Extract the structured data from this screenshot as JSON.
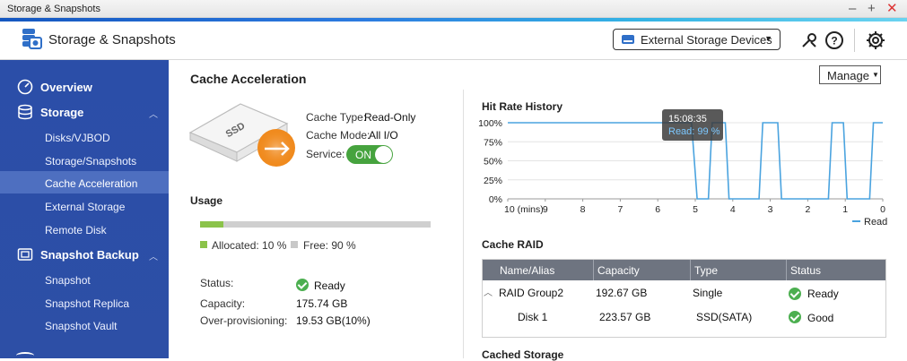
{
  "window": {
    "title": "Storage & Snapshots"
  },
  "header": {
    "app_title": "Storage & Snapshots",
    "external_devices_label": "External Storage Devices"
  },
  "sidebar": {
    "items": [
      {
        "label": "Overview",
        "type": "main"
      },
      {
        "label": "Storage",
        "type": "main"
      },
      {
        "label": "Disks/VJBOD",
        "type": "sub"
      },
      {
        "label": "Storage/Snapshots",
        "type": "sub"
      },
      {
        "label": "Cache Acceleration",
        "type": "sub",
        "selected": true
      },
      {
        "label": "External Storage",
        "type": "sub"
      },
      {
        "label": "Remote Disk",
        "type": "sub"
      },
      {
        "label": "Snapshot Backup",
        "type": "main"
      },
      {
        "label": "Snapshot",
        "type": "sub"
      },
      {
        "label": "Snapshot Replica",
        "type": "sub"
      },
      {
        "label": "Snapshot Vault",
        "type": "sub"
      }
    ]
  },
  "cache": {
    "title": "Cache Acceleration",
    "manage_label": "Manage",
    "ssd_text": "SSD",
    "type_label": "Cache Type:",
    "type_value": "Read-Only",
    "mode_label": "Cache Mode:",
    "mode_value": "All I/O",
    "service_label": "Service:",
    "service_state": "ON"
  },
  "usage": {
    "title": "Usage",
    "allocated_fraction": 0.1,
    "allocated_label": "Allocated: 10 %",
    "free_label": "Free: 90 %",
    "status_label": "Status:",
    "status_value": "Ready",
    "capacity_label": "Capacity:",
    "capacity_value": "175.74 GB",
    "overprov_label": "Over-provisioning:",
    "overprov_value": "19.53 GB(10%)"
  },
  "hit_rate": {
    "title": "Hit Rate History",
    "tooltip_time": "15:08:35",
    "tooltip_value": "Read: 99 %",
    "legend": "Read"
  },
  "chart_data": {
    "type": "line",
    "xlabel": "10 (mins)",
    "x_ticks": [
      "10 (mins)",
      "9",
      "8",
      "7",
      "6",
      "5",
      "4",
      "3",
      "2",
      "1",
      "0"
    ],
    "y_ticks": [
      "100%",
      "75%",
      "50%",
      "25%",
      "0%"
    ],
    "ylim": [
      0,
      100
    ],
    "xlim": [
      10,
      0
    ],
    "series": [
      {
        "name": "Read",
        "color": "#4aa3df",
        "x": [
          10,
          5.1,
          4.95,
          4.65,
          4.55,
          4.2,
          4.1,
          3.3,
          3.2,
          2.8,
          2.7,
          2.3,
          2.25,
          1.45,
          1.35,
          1.05,
          0.95,
          0.35,
          0.25,
          0
        ],
        "y": [
          100,
          100,
          0,
          0,
          100,
          100,
          0,
          0,
          100,
          100,
          0,
          0,
          0,
          0,
          100,
          100,
          0,
          0,
          100,
          100
        ]
      }
    ]
  },
  "raid": {
    "title": "Cache RAID",
    "headers": [
      "Name/Alias",
      "Capacity",
      "Type",
      "Status"
    ],
    "rows": [
      {
        "name": "RAID Group2",
        "capacity": "192.67 GB",
        "type": "Single",
        "status": "Ready"
      },
      {
        "name": "Disk 1",
        "capacity": "223.57 GB",
        "type": "SSD(SATA)",
        "status": "Good"
      }
    ]
  },
  "cached_storage": {
    "title": "Cached Storage"
  }
}
